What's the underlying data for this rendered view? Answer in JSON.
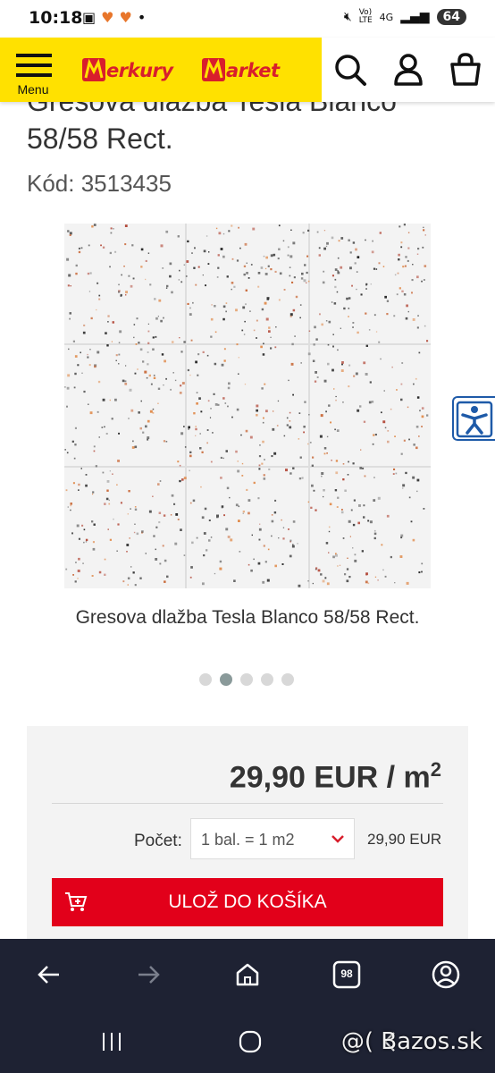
{
  "status_bar": {
    "time": "10:18",
    "left_icons": [
      "screenshot-icon",
      "app-icon",
      "app-icon",
      "dot-icon"
    ],
    "right_icons": [
      "mute-icon",
      "volte-icon",
      "4g-icon",
      "signal-icon"
    ],
    "network": "4G",
    "battery": "64"
  },
  "header": {
    "menu_label": "Menu",
    "logo": "MerkuryMarket",
    "icons": [
      "search-icon",
      "user-icon",
      "cart-icon"
    ],
    "brand_yellow": "#ffe100",
    "brand_red": "#d81e2c"
  },
  "product": {
    "title": "Gresova dlažba Tesla Blanco 58/58 Rect.",
    "code": "Kód: 3513435",
    "image_caption": "Gresova dlažba Tesla Blanco 58/58 Rect.",
    "gallery_count": 5,
    "gallery_active": 2
  },
  "buybox": {
    "price_main": "29,90 EUR / m",
    "price_exp": "2",
    "qty_label": "Počet:",
    "qty_value": "1 bal. = 1 m2",
    "qty_total": "29,90 EUR",
    "cart_button": "ULOŽ DO KOŠÍKA",
    "button_color": "#e2001a"
  },
  "browser_nav": {
    "icons": [
      "back-icon",
      "forward-icon",
      "home-icon",
      "tabs-icon",
      "account-icon"
    ],
    "tab_count": "98"
  },
  "system_nav": {
    "icons": [
      "recents-icon",
      "home-circle-icon",
      "back-chevron-icon"
    ]
  },
  "watermark": "@( Bazos.sk"
}
